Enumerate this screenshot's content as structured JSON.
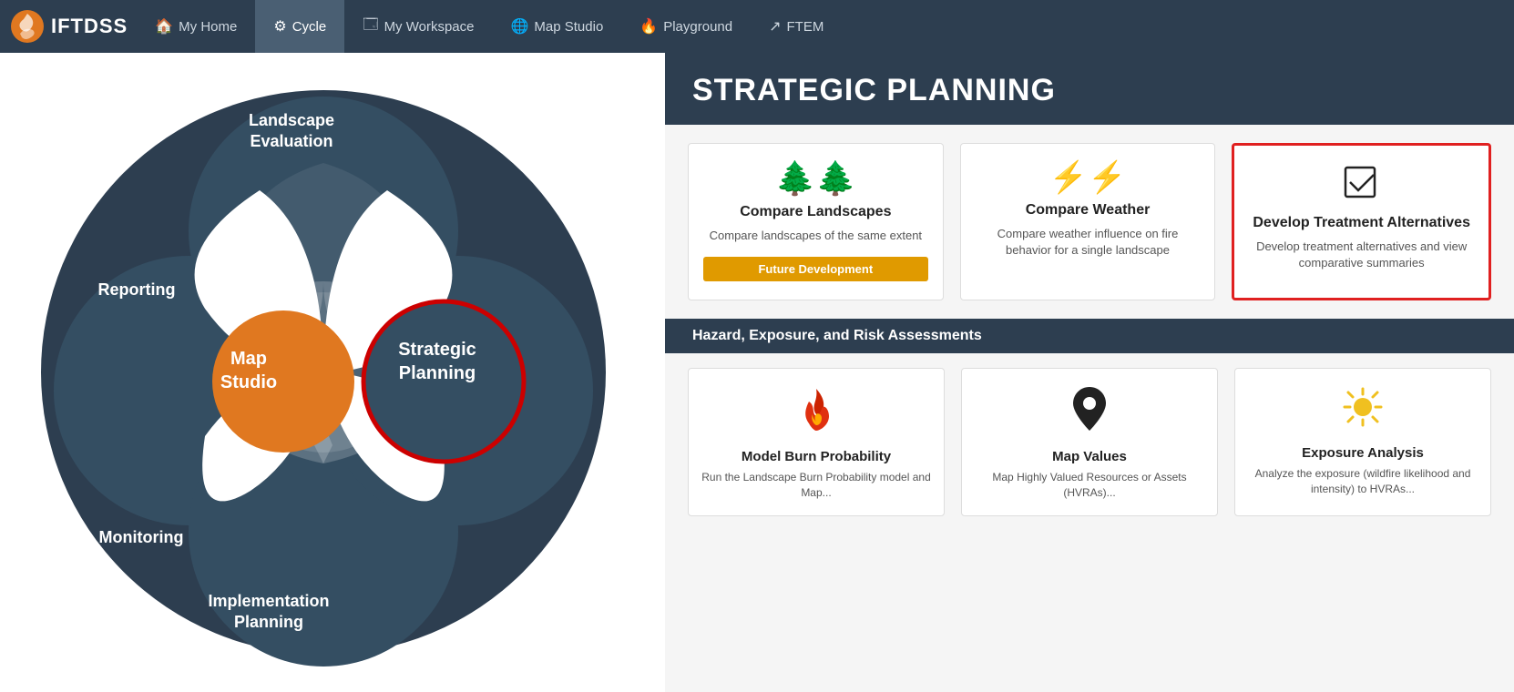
{
  "app": {
    "logo_text": "IFTDSS"
  },
  "navbar": {
    "items": [
      {
        "label": "My Home",
        "icon": "🏠",
        "active": false
      },
      {
        "label": "Cycle",
        "icon": "🔄",
        "active": true
      },
      {
        "label": "My Workspace",
        "icon": "🗔",
        "active": false
      },
      {
        "label": "Map Studio",
        "icon": "🌐",
        "active": false
      },
      {
        "label": "Playground",
        "icon": "🔥",
        "active": false
      },
      {
        "label": "FTEM",
        "icon": "↗",
        "active": false
      }
    ]
  },
  "strategic_planning": {
    "header": "STRATEGIC PLANNING",
    "section_header": "Hazard, Exposure, and Risk Assessments",
    "cards": [
      {
        "id": "compare-landscapes",
        "title": "Compare Landscapes",
        "desc": "Compare landscapes of the same extent",
        "badge": "Future Development",
        "selected": false
      },
      {
        "id": "compare-weather",
        "title": "Compare Weather",
        "desc": "Compare weather influence on fire behavior for a single landscape",
        "badge": null,
        "selected": false
      },
      {
        "id": "develop-treatment",
        "title": "Develop Treatment Alternatives",
        "desc": "Develop treatment alternatives and view comparative summaries",
        "badge": null,
        "selected": true
      }
    ],
    "bottom_cards": [
      {
        "id": "model-burn",
        "title": "Model Burn Probability",
        "desc": "Run the Landscape Burn Probability model and Map..."
      },
      {
        "id": "map-values",
        "title": "Map Values",
        "desc": "Map Highly Valued Resources or Assets (HVRAs)..."
      },
      {
        "id": "exposure-analysis",
        "title": "Exposure Analysis",
        "desc": "Analyze the exposure (wildfire likelihood and intensity) to HVRAs..."
      }
    ]
  },
  "cycle": {
    "labels": {
      "landscape": "Landscape\nEvaluation",
      "reporting": "Reporting",
      "monitoring": "Monitoring",
      "implementation": "Implementation\nPlanning",
      "map_studio": "Map\nStudio",
      "strategic": "Strategic\nPlanning"
    }
  }
}
